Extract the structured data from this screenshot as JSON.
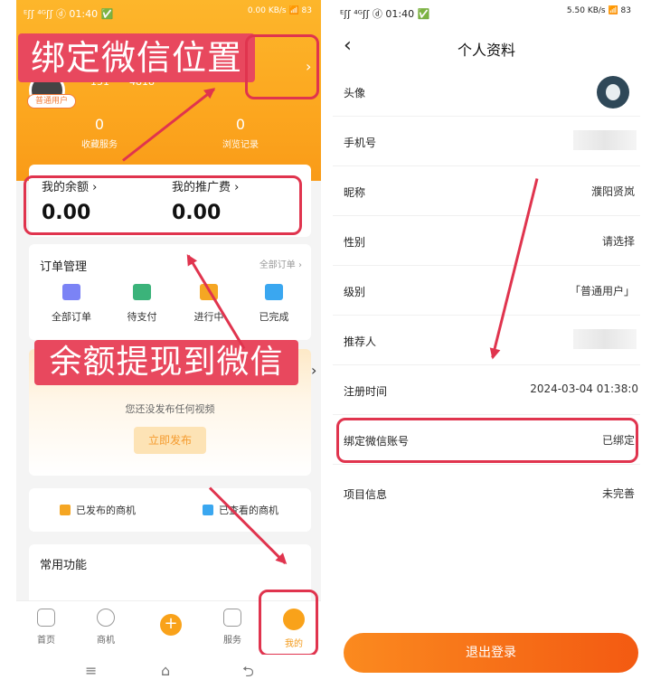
{
  "left": {
    "status": {
      "time": "ᴱʃʃ ⁴ᴳʃʃ ⓓ 01:40 ✅",
      "right": "0.00 KB/s 📶 83"
    },
    "annotation_top": "绑定微信位置",
    "annotation_middle": "余额提现到微信",
    "user": {
      "phone": "151****4818",
      "level": "普通用户"
    },
    "stats": [
      {
        "num": "0",
        "label": "收藏服务"
      },
      {
        "num": "0",
        "label": "浏览记录"
      }
    ],
    "balance": {
      "label": "我的余额",
      "value": "0.00"
    },
    "promo": {
      "label": "我的推广费",
      "value": "0.00"
    },
    "orders": {
      "title": "订单管理",
      "all": "全部订单",
      "items": [
        {
          "label": "全部订单",
          "icon": "wallet-icon",
          "color": "#7b83f5"
        },
        {
          "label": "待支付",
          "icon": "box-icon",
          "color": "#3bb37a"
        },
        {
          "label": "进行中",
          "icon": "robot-icon",
          "color": "#f5a623"
        },
        {
          "label": "已完成",
          "icon": "chat-icon",
          "color": "#3aa7f0"
        }
      ]
    },
    "video": {
      "empty": "您还没发布任何视频",
      "publish": "立即发布"
    },
    "business": [
      {
        "label": "已发布的商机",
        "icon": "send-icon",
        "color": "#f5a623"
      },
      {
        "label": "已查看的商机",
        "icon": "doc-icon",
        "color": "#3aa7f0"
      }
    ],
    "common": "常用功能",
    "tabs": [
      {
        "label": "首页",
        "icon": "home-icon"
      },
      {
        "label": "商机",
        "icon": "planet-icon"
      },
      {
        "label": "",
        "icon": "plus-icon"
      },
      {
        "label": "服务",
        "icon": "grid-icon"
      },
      {
        "label": "我的",
        "icon": "profile-icon"
      }
    ],
    "nav": [
      "≡",
      "⌂",
      "⮌"
    ]
  },
  "right": {
    "status": {
      "time": "ᴱʃʃ ⁴ᴳʃʃ ⓓ 01:40 ✅",
      "right": "5.50 KB/s 📶 83"
    },
    "title": "个人资料",
    "rows": [
      {
        "key": "头像",
        "value": ""
      },
      {
        "key": "手机号",
        "value": ""
      },
      {
        "key": "昵称",
        "value": "濮阳贤岚"
      },
      {
        "key": "性别",
        "value": "请选择"
      },
      {
        "key": "级别",
        "value": "「普通用户」"
      },
      {
        "key": "推荐人",
        "value": ""
      },
      {
        "key": "注册时间",
        "value": "2024-03-04 01:38:0"
      },
      {
        "key": "绑定微信账号",
        "value": "已绑定"
      },
      {
        "key": "项目信息",
        "value": "未完善"
      }
    ],
    "logout": "退出登录"
  }
}
